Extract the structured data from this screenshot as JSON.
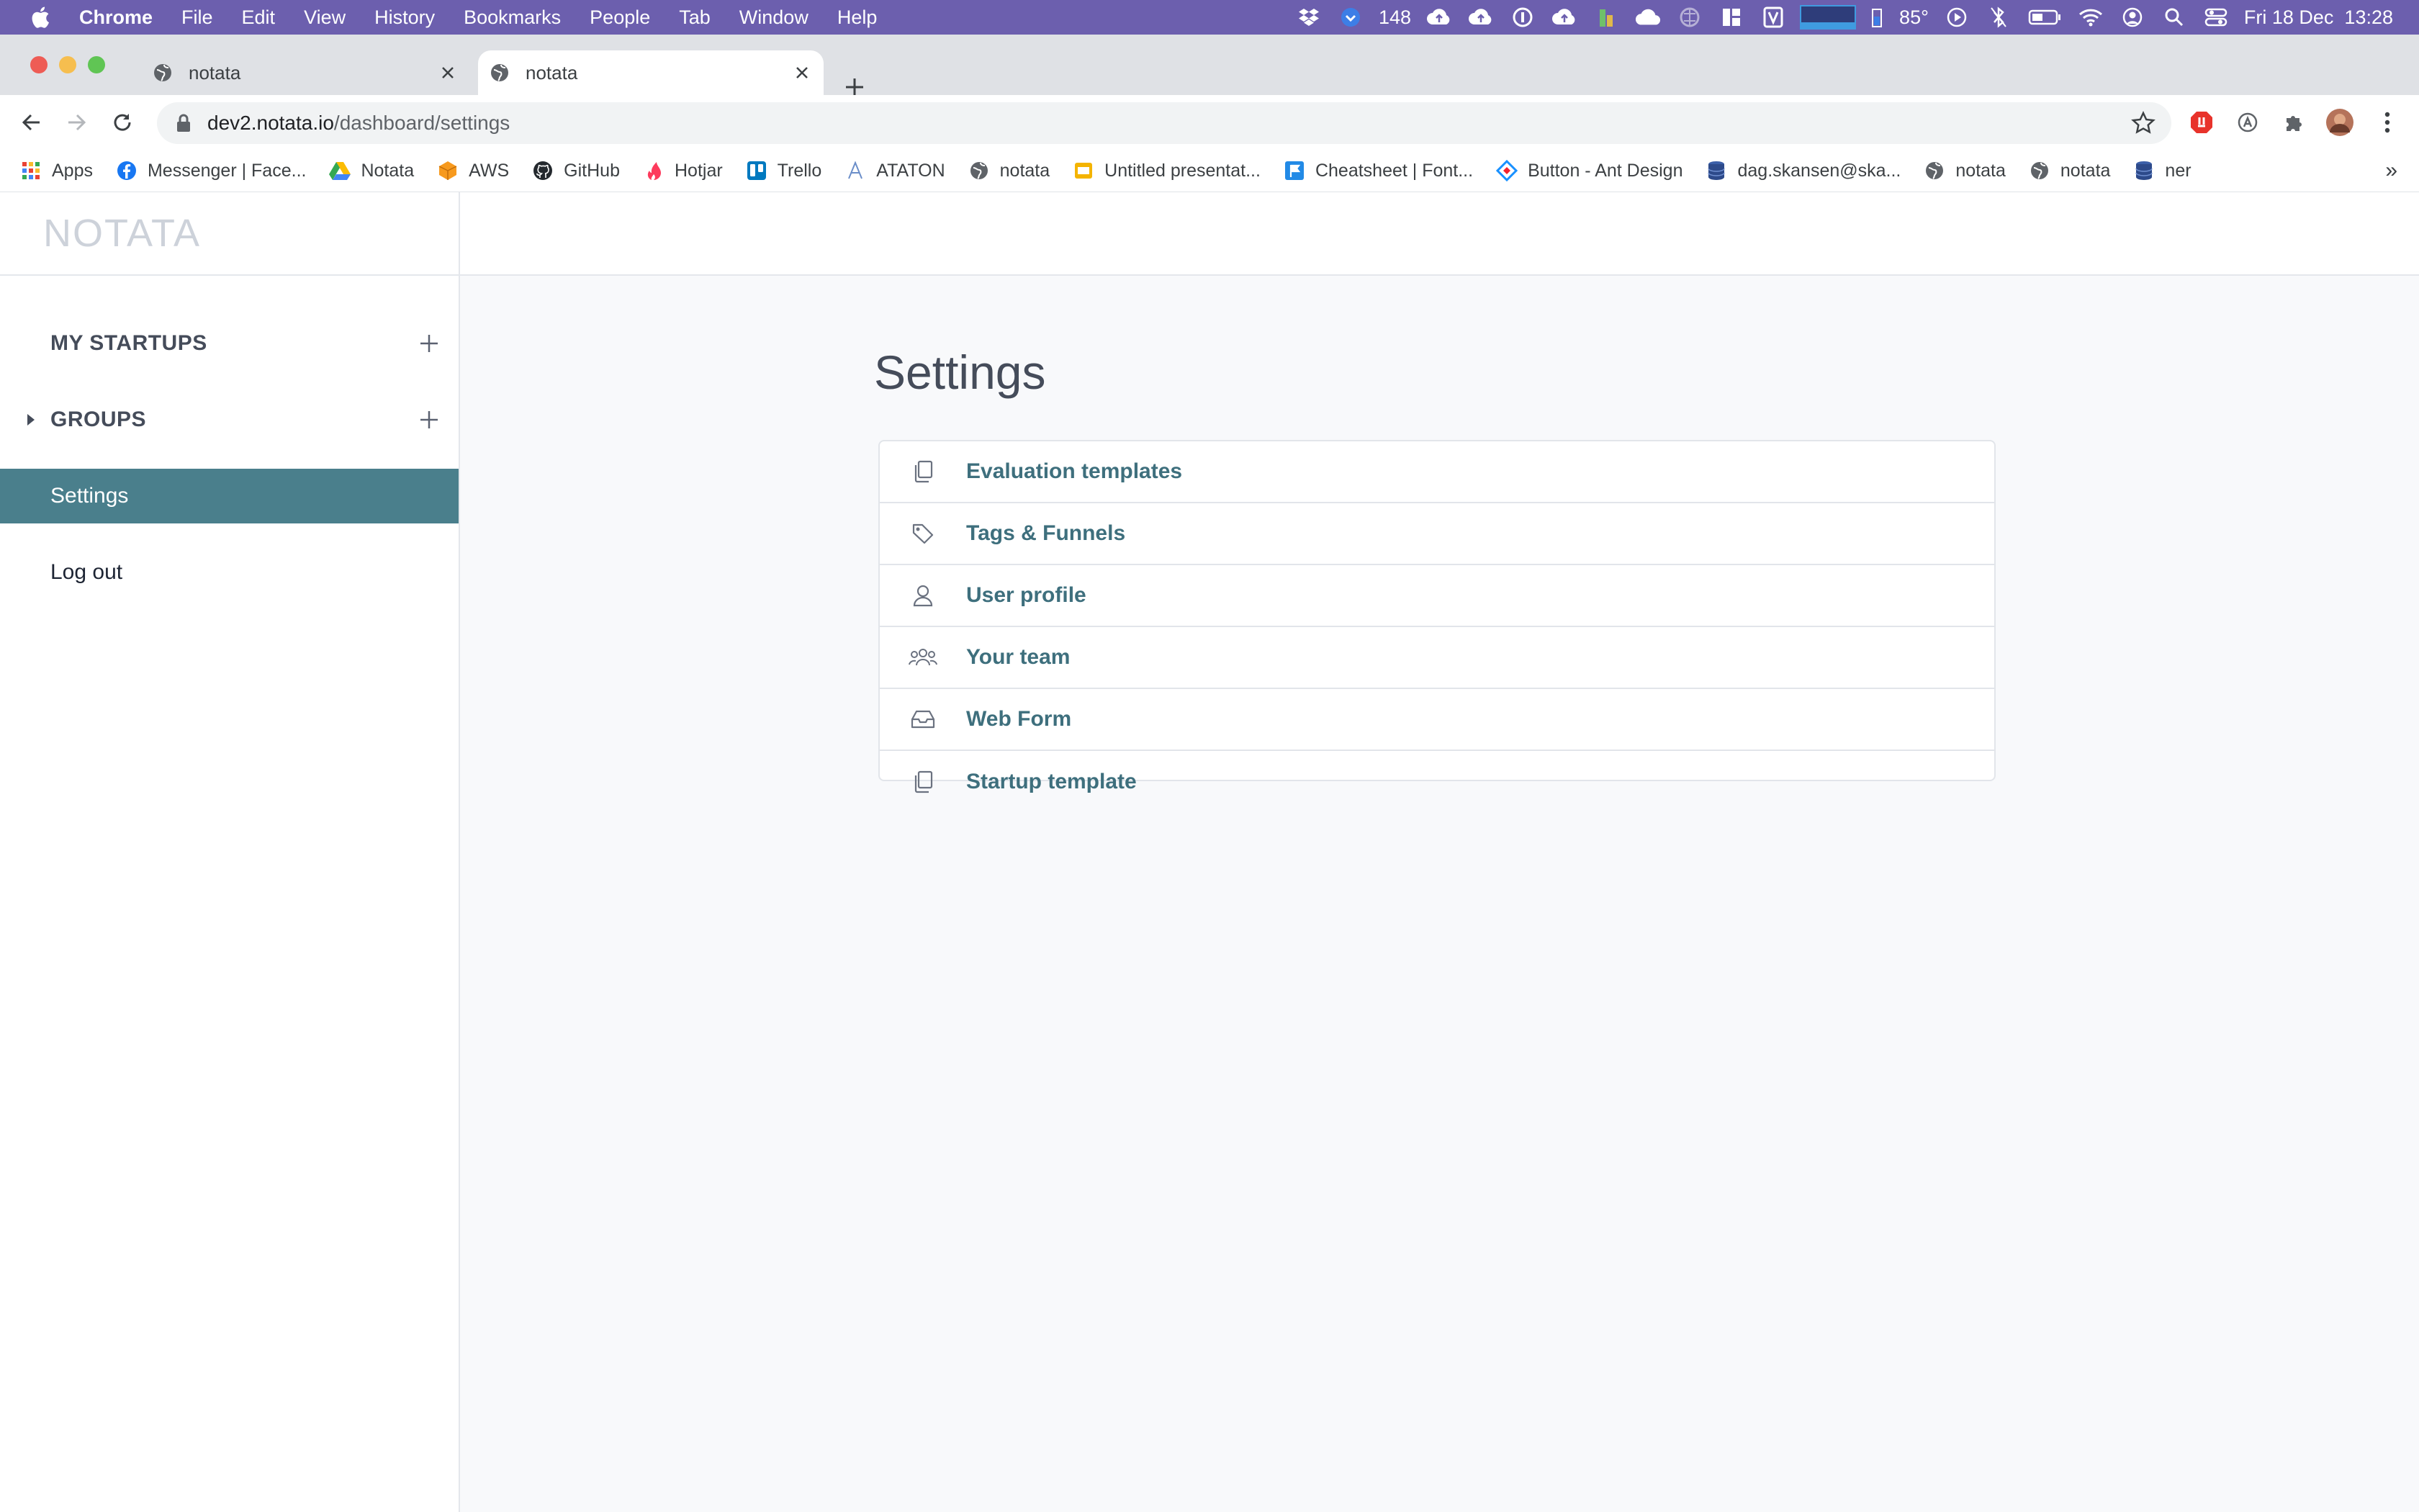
{
  "menubar": {
    "app_name": "Chrome",
    "items": [
      "File",
      "Edit",
      "View",
      "History",
      "Bookmarks",
      "People",
      "Tab",
      "Window",
      "Help"
    ],
    "status": {
      "badge_count": "148",
      "temperature": "85°",
      "datetime": "Fri 18 Dec  13:28"
    }
  },
  "browser": {
    "tabs": [
      {
        "title": "notata"
      },
      {
        "title": "notata",
        "active": true
      }
    ],
    "url": {
      "host": "dev2.notata.io",
      "path": "/dashboard/settings"
    },
    "bookmarks": [
      {
        "label": "Apps",
        "icon": "apps-grid-icon"
      },
      {
        "label": "Messenger | Face...",
        "icon": "facebook-icon"
      },
      {
        "label": "Notata",
        "icon": "google-drive-icon"
      },
      {
        "label": "AWS",
        "icon": "aws-cube-icon"
      },
      {
        "label": "GitHub",
        "icon": "github-icon"
      },
      {
        "label": "Hotjar",
        "icon": "hotjar-flame-icon"
      },
      {
        "label": "Trello",
        "icon": "trello-icon"
      },
      {
        "label": "ATATON",
        "icon": "ataton-icon"
      },
      {
        "label": "notata",
        "icon": "globe-icon"
      },
      {
        "label": "Untitled presentat...",
        "icon": "slides-icon"
      },
      {
        "label": "Cheatsheet | Font...",
        "icon": "flag-icon"
      },
      {
        "label": "Button - Ant Design",
        "icon": "ant-design-icon"
      },
      {
        "label": "dag.skansen@ska...",
        "icon": "database-icon"
      },
      {
        "label": "notata",
        "icon": "globe-icon"
      },
      {
        "label": "notata",
        "icon": "globe-icon"
      },
      {
        "label": "ner",
        "icon": "database-icon"
      }
    ],
    "bookmarks_overflow": "»"
  },
  "app": {
    "logo": "NOTATA",
    "sidebar": {
      "items": [
        {
          "label": "MY STARTUPS",
          "has_add": true
        },
        {
          "label": "GROUPS",
          "has_add": true,
          "has_caret": true
        },
        {
          "label": "Settings",
          "active": true
        },
        {
          "label": "Log out"
        }
      ]
    },
    "main": {
      "title": "Settings",
      "settings_items": [
        {
          "label": "Evaluation templates",
          "icon": "copy-icon"
        },
        {
          "label": "Tags & Funnels",
          "icon": "tag-icon"
        },
        {
          "label": "User profile",
          "icon": "user-icon"
        },
        {
          "label": "Your team",
          "icon": "team-icon"
        },
        {
          "label": "Web Form",
          "icon": "inbox-icon"
        },
        {
          "label": "Startup template",
          "icon": "copy-icon"
        }
      ]
    }
  },
  "colors": {
    "menubar_bg": "#6c5fae",
    "sidebar_active": "#4a7f8c",
    "link_text": "#3e6f7d",
    "page_bg": "#f8f9fb"
  }
}
